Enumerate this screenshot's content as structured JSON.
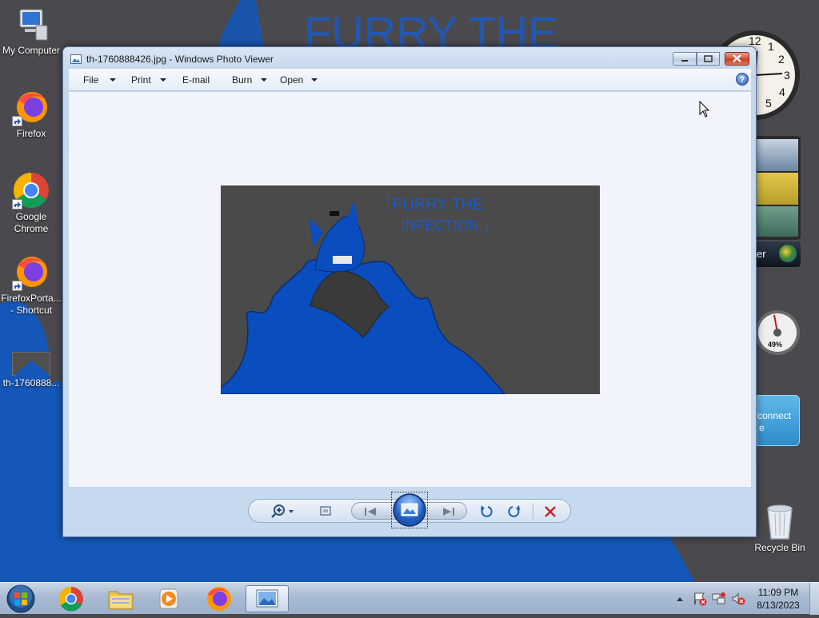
{
  "desktop": {
    "icons": [
      {
        "label": "My Computer"
      },
      {
        "label": "Firefox"
      },
      {
        "label": "Google Chrome"
      },
      {
        "label": "FirefoxPorta... - Shortcut"
      },
      {
        "label": "th-1760888..."
      },
      {
        "label": "Recycle Bin"
      }
    ],
    "wallpaper_text": "FURRY THE",
    "gadgets": {
      "cpu_meter_value": "49%",
      "connect_text_1": "connect",
      "connect_text_2": "e",
      "slideshow_text": "er"
    }
  },
  "window": {
    "title": "th-1760888426.jpg - Windows Photo Viewer",
    "menu": [
      {
        "label": "File"
      },
      {
        "label": "Print"
      },
      {
        "label": "E-mail"
      },
      {
        "label": "Burn"
      },
      {
        "label": "Open"
      }
    ],
    "help_label": "?",
    "photo_caption_1": "「FURRY THE",
    "photo_caption_2": "INFECTION 」"
  },
  "taskbar": {
    "clock_time": "11:09 PM",
    "clock_date": "8/13/2023"
  },
  "colors": {
    "desktop_blue": "#1557b8",
    "desktop_gray": "#4a4a4e",
    "photo_bg": "#4a4a4a",
    "photo_blue": "#0a4dbe",
    "close_red": "#c33a20"
  }
}
